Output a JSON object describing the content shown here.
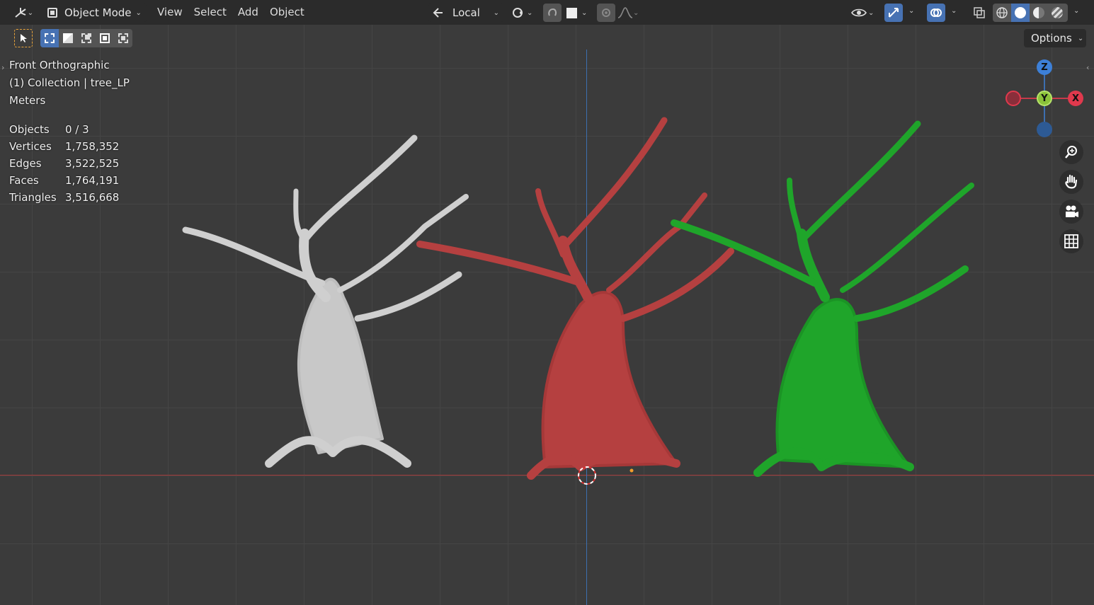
{
  "header": {
    "editor_type_icon": "editor-type-icon",
    "mode": "Object Mode",
    "menus": [
      "View",
      "Select",
      "Add",
      "Object"
    ],
    "transform_orientation": "Local",
    "viewport_shading": "solid"
  },
  "toolbar": {
    "options_label": "Options"
  },
  "overlay_info": {
    "view_name": "Front Orthographic",
    "collection": "(1) Collection | tree_LP",
    "units": "Meters"
  },
  "stats": [
    {
      "label": "Objects",
      "value": "0 / 3"
    },
    {
      "label": "Vertices",
      "value": "1,758,352"
    },
    {
      "label": "Edges",
      "value": "3,522,525"
    },
    {
      "label": "Faces",
      "value": "1,764,191"
    },
    {
      "label": "Triangles",
      "value": "3,516,668"
    }
  ],
  "gizmo": {
    "z_label": "Z",
    "y_label": "Y",
    "x_label": "X"
  },
  "colors": {
    "tree_left": "#cfcfcf",
    "tree_middle": "#b54040",
    "tree_right": "#1fa52a",
    "x_axis_line": "#a33a3a",
    "z_axis_line": "#3d6fb0",
    "accent_blue": "#4772b3"
  }
}
